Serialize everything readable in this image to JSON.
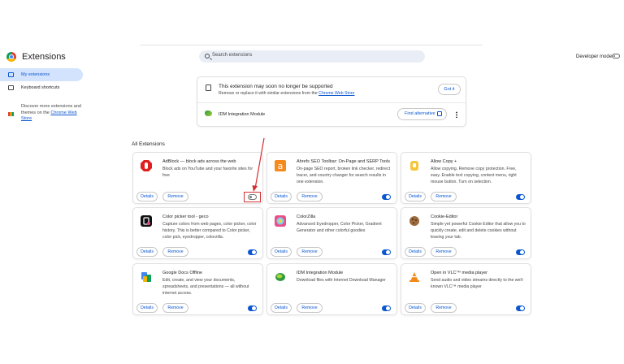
{
  "header": {
    "title": "Extensions",
    "search_placeholder": "Search extensions",
    "developer_mode_label": "Developer mode",
    "developer_mode_on": false
  },
  "sidebar": {
    "items": [
      {
        "label": "My extensions",
        "active": true
      },
      {
        "label": "Keyboard shortcuts",
        "active": false
      }
    ],
    "discover_text": "Discover more extensions and themes on the ",
    "discover_link": "Chrome Web Store"
  },
  "warning": {
    "title": "This extension may soon no longer be supported",
    "subtitle": "Remove or replace it with similar extensions from the ",
    "subtitle_link": "Chrome Web Store",
    "got_it_label": "Got it",
    "extension_name": "IDM Integration Module",
    "find_alternative_label": "Find alternative"
  },
  "section_title": "All Extensions",
  "buttons": {
    "details": "Details",
    "remove": "Remove"
  },
  "extensions": [
    {
      "name": "AdBlock — block ads across the web",
      "desc": "Block ads on YouTube and your favorite sites for free",
      "enabled": false,
      "icon": "adblock-icon"
    },
    {
      "name": "Ahrefs SEO Toolbar: On-Page and SERP Tools",
      "desc": "On-page SEO report, broken link checker, redirect tracer, and country changer for search results in one extension.",
      "enabled": true,
      "icon": "ahrefs-icon"
    },
    {
      "name": "Allow Copy +",
      "desc": "Allow copying. Remove copy protection. Free, easy. Enable text copying, context menu, right mouse button. Turn on selection.",
      "enabled": true,
      "icon": "allow-copy-icon"
    },
    {
      "name": "Color picker tool - geco",
      "desc": "Capture colors from web pages, color picker, color history. This is better compared to Color picker, color pick, eyedropper, colorzilla.",
      "enabled": true,
      "icon": "geco-icon"
    },
    {
      "name": "ColorZilla",
      "desc": "Advanced Eyedropper, Color Picker, Gradient Generator and other colorful goodies",
      "enabled": true,
      "icon": "colorzilla-icon"
    },
    {
      "name": "Cookie-Editor",
      "desc": "Simple yet powerful Cookie Editor that allow you to quickly create, edit and delete cookies without leaving your tab.",
      "enabled": true,
      "icon": "cookie-icon"
    },
    {
      "name": "Google Docs Offline",
      "desc": "Edit, create, and view your documents, spreadsheets, and presentations — all without internet access.",
      "enabled": true,
      "icon": "google-docs-icon"
    },
    {
      "name": "IDM Integration Module",
      "desc": "Download files with Internet Download Manager",
      "enabled": true,
      "icon": "idm-icon"
    },
    {
      "name": "Open in VLC™ media player",
      "desc": "Send audio and video streams directly to the well-known VLC™ media player",
      "enabled": true,
      "icon": "vlc-icon"
    }
  ],
  "colors": {
    "accent": "#0b57d0",
    "highlight": "#d32f2f"
  }
}
